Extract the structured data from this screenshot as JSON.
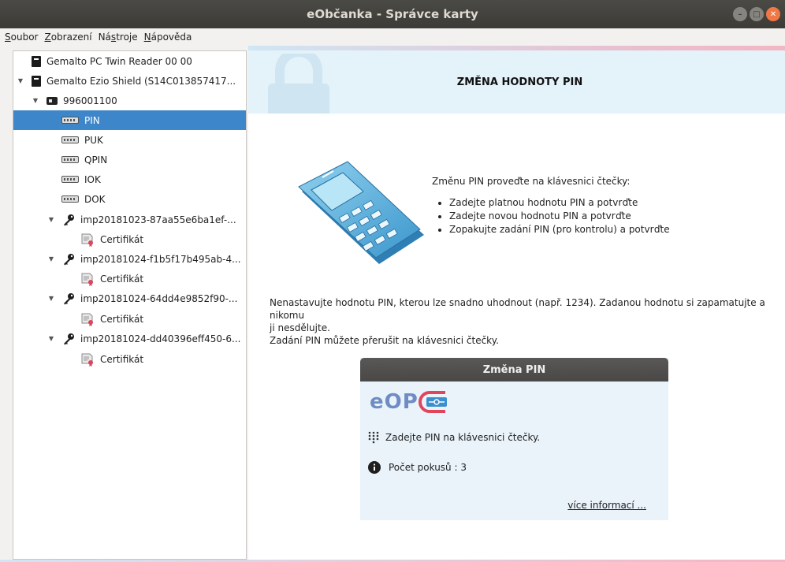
{
  "window": {
    "title": "eObčanka - Správce karty"
  },
  "menu": [
    {
      "label": "Soubor",
      "mnemonic": "S",
      "rest": "oubor"
    },
    {
      "label": "Zobrazení",
      "mnemonic": "Z",
      "rest": "obrazení"
    },
    {
      "label": "Nástroje",
      "prefix": "Ná",
      "mnemonic": "s",
      "rest": "troje"
    },
    {
      "label": "Nápověda",
      "mnemonic": "N",
      "rest": "ápověda"
    }
  ],
  "tree": {
    "reader1": "Gemalto PC Twin Reader 00 00",
    "reader2": "Gemalto Ezio Shield (S14C013857417...",
    "card": "996001100",
    "items": [
      "PIN",
      "PUK",
      "QPIN",
      "IOK",
      "DOK"
    ],
    "selected": "PIN",
    "keys": [
      {
        "label": "imp20181023-87aa55e6ba1ef-...",
        "cert": "Certifikát"
      },
      {
        "label": "imp20181024-f1b5f17b495ab-4...",
        "cert": "Certifikát"
      },
      {
        "label": "imp20181024-64dd4e9852f90-...",
        "cert": "Certifikát"
      },
      {
        "label": "imp20181024-dd40396eff450-6...",
        "cert": "Certifikát"
      }
    ]
  },
  "panel": {
    "title": "ZMĚNA HODNOTY PIN",
    "instructions_intro": "Změnu PIN proveďte na klávesnici čtečky:",
    "steps": [
      "Zadejte platnou hodnotu PIN a potvrďte",
      "Zadejte novou hodnotu PIN a potvrďte",
      "Zopakujte zadání PIN (pro kontrolu) a potvrďte"
    ],
    "warning_line1": "Nenastavujte hodnotu PIN, kterou lze snadno uhodnout (např. 1234). Zadanou hodnotu si zapamatujte a nikomu",
    "warning_line2": "ji nesdělujte.",
    "warning_line3": "Zadání PIN můžete přerušit na klávesnici čtečky."
  },
  "dialog": {
    "title": "Změna PIN",
    "logo_text": "eOP",
    "prompt": "Zadejte PIN na klávesnici čtečky.",
    "attempts": "Počet pokusů : 3",
    "more_link": "více informací ..."
  },
  "colors": {
    "selection": "#3c86c9",
    "header_band": "#e4f2fa",
    "dialog_bg": "#eaf3fa",
    "logo_blue": "#6f8cc4",
    "logo_red": "#e0455e"
  }
}
